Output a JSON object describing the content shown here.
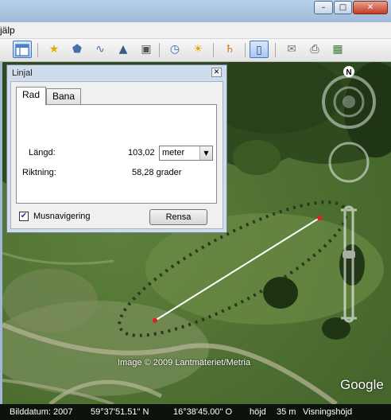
{
  "window": {
    "minimize_icon": "minimize-icon",
    "maximize_icon": "maximize-icon",
    "close_icon": "close-icon"
  },
  "menu": {
    "visible_item": "jälp"
  },
  "toolbar": {
    "icons": [
      "sidebar-icon",
      "placemark-icon",
      "polygon-icon",
      "path-icon",
      "overlay-icon",
      "record-tour-icon",
      "historical-imagery-icon",
      "sunlight-icon",
      "planet-icon",
      "ruler-icon",
      "email-icon",
      "print-icon",
      "save-image-icon"
    ],
    "active": "ruler-icon"
  },
  "dialog": {
    "title": "Linjal",
    "tabs": [
      "Rad",
      "Bana"
    ],
    "selected_tab": "Rad",
    "length_label": "Längd:",
    "length_value": "103,02",
    "unit_selected": "meter",
    "direction_label": "Riktning:",
    "direction_value": "58,28 grader",
    "mouse_nav_label": "Musnavigering",
    "mouse_nav_checked": true,
    "clear_button": "Rensa"
  },
  "map": {
    "copyright": "Image © 2009 Lantmäteriet/Metria",
    "logo": "Google",
    "compass_label": "N",
    "ruler_line_color": "#ffffff",
    "ruler_endpoint_color": "#e02020"
  },
  "status": {
    "imagery_date": "Bilddatum: 2007",
    "latitude": "59°37'51.51\" N",
    "longitude": "16°38'45.00\" O",
    "elevation_label": "höjd",
    "elevation_value": "35 m",
    "eye_altitude_label": "Visningshöjd"
  }
}
